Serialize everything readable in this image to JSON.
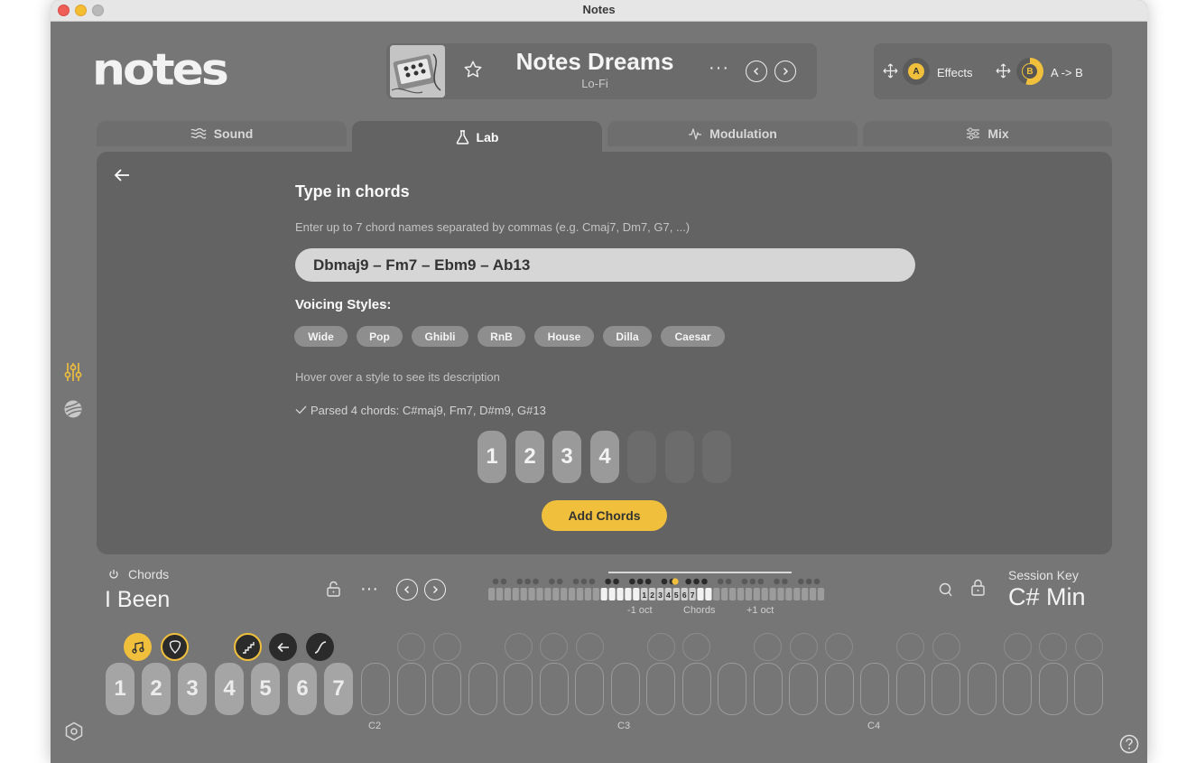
{
  "window": {
    "title": "Notes"
  },
  "app": {
    "logo": "notes"
  },
  "preset": {
    "name": "Notes Dreams",
    "category": "Lo-Fi",
    "more": "···",
    "prev_icon": "chevron-left-icon",
    "next_icon": "chevron-right-icon"
  },
  "fx": {
    "a_label": "Effects",
    "a_badge": "A",
    "b_label": "A -> B",
    "b_badge": "B"
  },
  "tabs": [
    {
      "label": "Sound",
      "icon": "waves-icon"
    },
    {
      "label": "Lab",
      "icon": "flask-icon"
    },
    {
      "label": "Modulation",
      "icon": "pulse-icon"
    },
    {
      "label": "Mix",
      "icon": "sliders-icon"
    }
  ],
  "lab": {
    "title": "Type in chords",
    "hint": "Enter up to 7 chord names separated by commas (e.g. Cmaj7, Dm7, G7, ...)",
    "input_value": "Dbmaj9 – Fm7 – Ebm9 – Ab13",
    "voicing_label": "Voicing Styles:",
    "styles": [
      "Wide",
      "Pop",
      "Ghibli",
      "RnB",
      "House",
      "Dilla",
      "Caesar"
    ],
    "hover_hint": "Hover over a style to see its description",
    "parsed": "Parsed 4 chords: C#maj9, Fm7, D#m9, G#13",
    "slots": [
      "1",
      "2",
      "3",
      "4",
      "",
      "",
      ""
    ],
    "add_button": "Add Chords"
  },
  "bottom": {
    "chords_label": "Chords",
    "chords_name": "I Been",
    "session_label": "Session Key",
    "session_key": "C# Min",
    "oct_minus": "-1 oct",
    "oct_center": "Chords",
    "oct_plus": "+1 oct",
    "strip_numbers": [
      "1",
      "2",
      "3",
      "4",
      "5",
      "6",
      "7"
    ],
    "key_numbers": [
      "1",
      "2",
      "3",
      "4",
      "5",
      "6",
      "7"
    ],
    "c_labels": [
      "C2",
      "C3",
      "C4"
    ]
  },
  "colors": {
    "accent": "#f0c03c",
    "panel": "#636363",
    "background": "#767676"
  }
}
